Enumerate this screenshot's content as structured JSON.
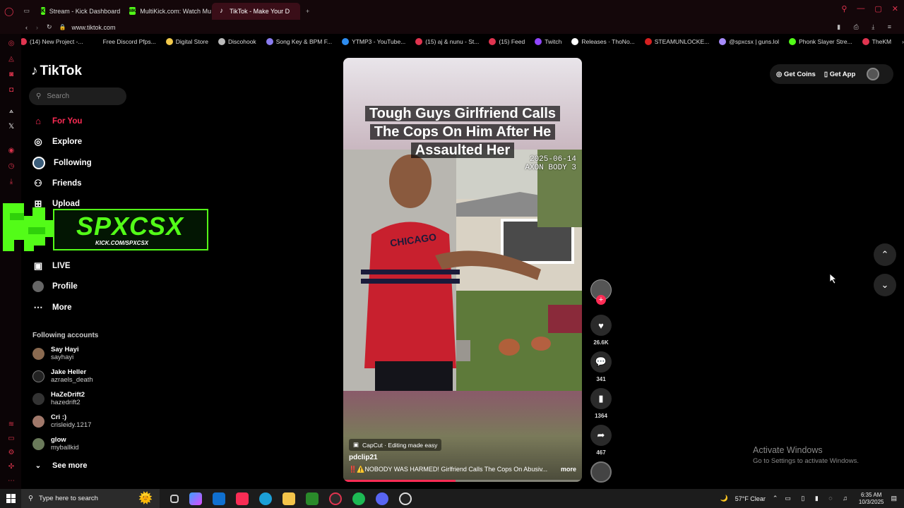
{
  "browser": {
    "tabs": [
      {
        "label": "Stream - Kick Dashboard"
      },
      {
        "label": "MultiKick.com: Watch Mu"
      },
      {
        "label": "TikTok - Make Your D"
      }
    ],
    "url": "www.tiktok.com",
    "bookmarks": [
      {
        "label": "(14) New Project -...",
        "color": "#e0344f"
      },
      {
        "label": "Free Discord Pfps...",
        "color": "#000000"
      },
      {
        "label": "Digital Store",
        "color": "#f2c94c"
      },
      {
        "label": "Discohook",
        "color": "#bbbbbb"
      },
      {
        "label": "Song Key & BPM F...",
        "color": "#8a7cf0"
      },
      {
        "label": "YTMP3 - YouTube...",
        "color": "#2d8cf0"
      },
      {
        "label": "(15) aj & nunu - St...",
        "color": "#e0344f"
      },
      {
        "label": "(15) Feed",
        "color": "#e0344f"
      },
      {
        "label": "Twitch",
        "color": "#9146ff"
      },
      {
        "label": "Releases · ThoNo...",
        "color": "#ffffff"
      },
      {
        "label": "STEAMUNLOCKE...",
        "color": "#d62020"
      },
      {
        "label": "@spxcsx | guns.lol",
        "color": "#a78bfa"
      },
      {
        "label": "Phonk Slayer Stre...",
        "color": "#53fc18"
      },
      {
        "label": "TheKM",
        "color": "#e0344f"
      }
    ]
  },
  "tiktok": {
    "logo": "TikTok",
    "search_placeholder": "Search",
    "nav": [
      {
        "label": "For You",
        "icon": "home-icon",
        "active": true
      },
      {
        "label": "Explore",
        "icon": "compass-icon"
      },
      {
        "label": "Following",
        "icon": "following-avatar-icon"
      },
      {
        "label": "Friends",
        "icon": "friends-icon"
      },
      {
        "label": "Upload",
        "icon": "upload-icon"
      },
      {
        "label": "LIVE",
        "icon": "live-icon"
      },
      {
        "label": "Profile",
        "icon": "profile-icon"
      },
      {
        "label": "More",
        "icon": "more-icon"
      }
    ],
    "following_header": "Following accounts",
    "following": [
      {
        "name": "Say Hayi",
        "handle": "sayhayi"
      },
      {
        "name": "Jake Heller",
        "handle": "azraels_death"
      },
      {
        "name": "HaZeDrift2",
        "handle": "hazedrift2"
      },
      {
        "name": "Cri :)",
        "handle": "crisleidy.1217"
      },
      {
        "name": "glow",
        "handle": "myballkid"
      }
    ],
    "see_more": "See more",
    "get_coins": "Get Coins",
    "get_app": "Get App"
  },
  "overlay": {
    "brand": "SPXCSX",
    "url": "KICK.COM/SPXCSX"
  },
  "video": {
    "title": [
      "Tough Guys Girlfriend Calls",
      "The Cops On Him After He",
      "Assaulted Her"
    ],
    "stamp_date": "2025-06-14",
    "stamp_cam": "AXON BODY 3",
    "jersey": "CHICAGO",
    "capcut": "CapCut · Editing made easy",
    "author": "pdclip21",
    "caption": "‼️⚠️NOBODY WAS HARMED! Girlfriend Calls The Cops On Abusiv...",
    "more": "more",
    "progress": 0.47
  },
  "actions": {
    "likes": "26.6K",
    "comments": "341",
    "saves": "1364",
    "shares": "467"
  },
  "activate": {
    "title": "Activate Windows",
    "sub": "Go to Settings to activate Windows."
  },
  "taskbar": {
    "search_placeholder": "Type here to search",
    "weather": "57°F  Clear",
    "time": "6:35 AM",
    "date": "10/3/2025"
  }
}
